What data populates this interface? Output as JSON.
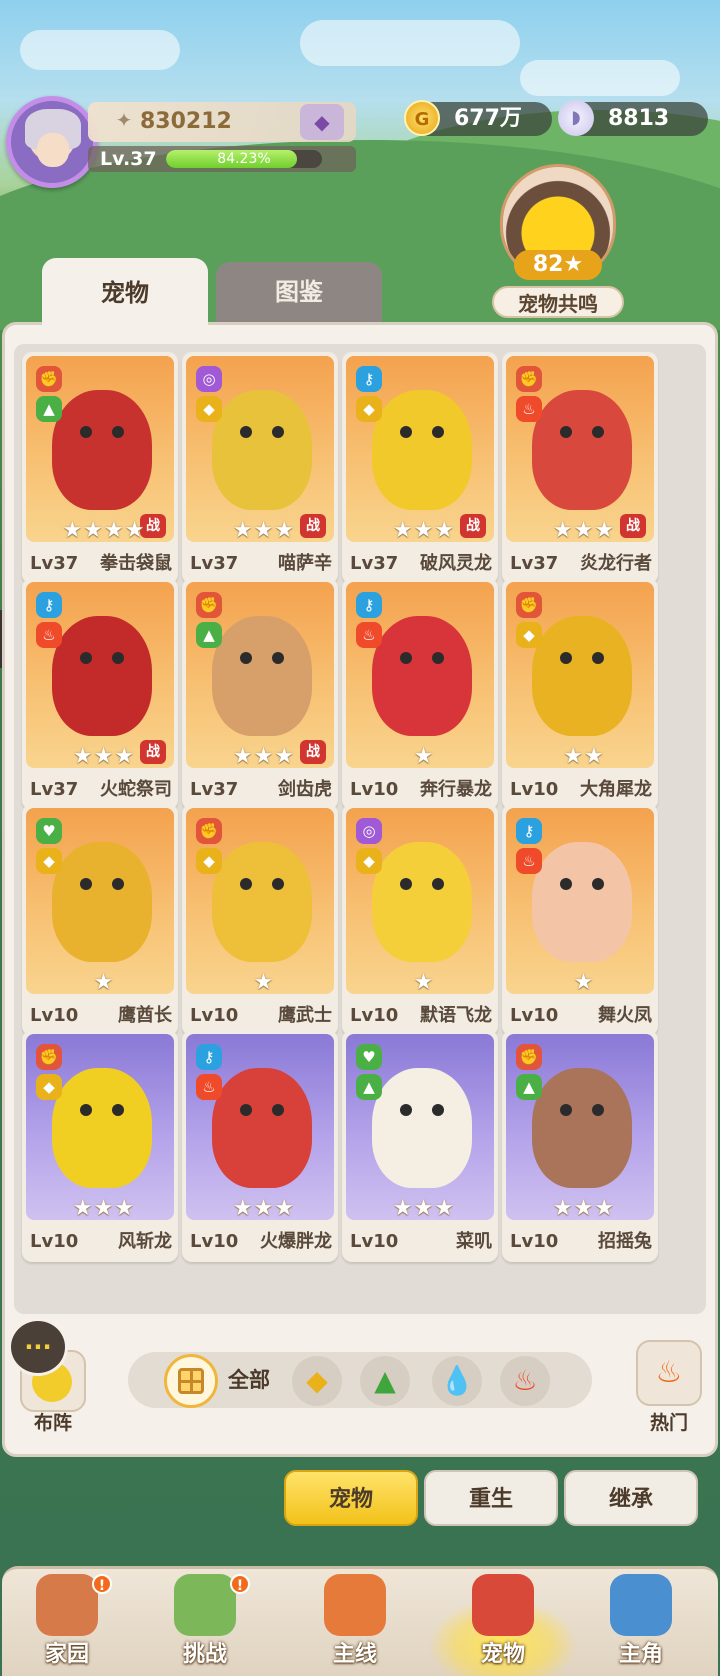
{
  "player": {
    "power": "830212",
    "level": "Lv.37",
    "exp_percent_text": "84.23%",
    "exp_fraction": 0.8423
  },
  "currency": {
    "gold": "677万",
    "shells": "8813"
  },
  "resonance": {
    "value": "82★",
    "label": "宠物共鸣"
  },
  "tabs": [
    {
      "label": "宠物",
      "active": true
    },
    {
      "label": "图鉴",
      "active": false
    }
  ],
  "pets": [
    {
      "level": "Lv37",
      "name": "拳击袋鼠",
      "stars": "★★★★",
      "war": "战",
      "frame": "orange",
      "badges": [
        "fist-icon",
        "leaf-icon"
      ],
      "badge_glyphs": [
        "✊",
        "▲"
      ],
      "badge_colors": [
        "#e2553a",
        "#4ab046"
      ],
      "body": "#c8322e"
    },
    {
      "level": "Lv37",
      "name": "喵萨辛",
      "stars": "★★★",
      "war": "战",
      "frame": "orange",
      "badges": [
        "magic-icon",
        "earth-icon"
      ],
      "badge_glyphs": [
        "◎",
        "◆"
      ],
      "badge_colors": [
        "#a05ad6",
        "#e9b21a"
      ],
      "body": "#e8c23a"
    },
    {
      "level": "Lv37",
      "name": "破风灵龙",
      "stars": "★★★",
      "war": "战",
      "frame": "orange",
      "badges": [
        "key-icon",
        "earth-icon"
      ],
      "badge_glyphs": [
        "⚷",
        "◆"
      ],
      "badge_colors": [
        "#2ba1e0",
        "#e9b21a"
      ],
      "body": "#f2c92a"
    },
    {
      "level": "Lv37",
      "name": "炎龙行者",
      "stars": "★★★",
      "war": "战",
      "frame": "orange",
      "badges": [
        "fist-icon",
        "fire-icon"
      ],
      "badge_glyphs": [
        "✊",
        "♨"
      ],
      "badge_colors": [
        "#e2553a",
        "#ef4a2a"
      ],
      "body": "#d9483c"
    },
    {
      "level": "Lv37",
      "name": "火蛇祭司",
      "stars": "★★★",
      "war": "战",
      "frame": "orange",
      "badges": [
        "key-icon",
        "fire-icon"
      ],
      "badge_glyphs": [
        "⚷",
        "♨"
      ],
      "badge_colors": [
        "#2ba1e0",
        "#ef4a2a"
      ],
      "body": "#c32a2a"
    },
    {
      "level": "Lv37",
      "name": "剑齿虎",
      "stars": "★★★",
      "war": "战",
      "frame": "orange",
      "badges": [
        "fist-icon",
        "leaf-icon"
      ],
      "badge_glyphs": [
        "✊",
        "▲"
      ],
      "badge_colors": [
        "#e2553a",
        "#4ab046"
      ],
      "body": "#d7a06a"
    },
    {
      "level": "Lv10",
      "name": "奔行暴龙",
      "stars": "★",
      "war": "",
      "frame": "orange",
      "badges": [
        "key-icon",
        "fire-icon"
      ],
      "badge_glyphs": [
        "⚷",
        "♨"
      ],
      "badge_colors": [
        "#2ba1e0",
        "#ef4a2a"
      ],
      "body": "#d8353a"
    },
    {
      "level": "Lv10",
      "name": "大角犀龙",
      "stars": "★★",
      "war": "",
      "frame": "orange",
      "badges": [
        "fist-icon",
        "earth-icon"
      ],
      "badge_glyphs": [
        "✊",
        "◆"
      ],
      "badge_colors": [
        "#e2553a",
        "#e9b21a"
      ],
      "body": "#e9b222"
    },
    {
      "level": "Lv10",
      "name": "鹰酋长",
      "stars": "★",
      "war": "",
      "frame": "orange",
      "badges": [
        "heart-icon",
        "earth-icon"
      ],
      "badge_glyphs": [
        "♥",
        "◆"
      ],
      "badge_colors": [
        "#4ab046",
        "#e9b21a"
      ],
      "body": "#e8b22e"
    },
    {
      "level": "Lv10",
      "name": "鹰武士",
      "stars": "★",
      "war": "",
      "frame": "orange",
      "badges": [
        "fist-icon",
        "earth-icon"
      ],
      "badge_glyphs": [
        "✊",
        "◆"
      ],
      "badge_colors": [
        "#e2553a",
        "#e9b21a"
      ],
      "body": "#eec03a"
    },
    {
      "level": "Lv10",
      "name": "默语飞龙",
      "stars": "★",
      "war": "",
      "frame": "orange",
      "badges": [
        "magic-icon",
        "earth-icon"
      ],
      "badge_glyphs": [
        "◎",
        "◆"
      ],
      "badge_colors": [
        "#a05ad6",
        "#e9b21a"
      ],
      "body": "#f4cf3a"
    },
    {
      "level": "Lv10",
      "name": "舞火凤",
      "stars": "★",
      "war": "",
      "frame": "orange",
      "badges": [
        "key-icon",
        "fire-icon"
      ],
      "badge_glyphs": [
        "⚷",
        "♨"
      ],
      "badge_colors": [
        "#2ba1e0",
        "#ef4a2a"
      ],
      "body": "#f4c4a6"
    },
    {
      "level": "Lv10",
      "name": "风斩龙",
      "stars": "★★★",
      "war": "",
      "frame": "purple",
      "badges": [
        "fist-icon",
        "earth-icon"
      ],
      "badge_glyphs": [
        "✊",
        "◆"
      ],
      "badge_colors": [
        "#e2553a",
        "#e9b21a"
      ],
      "body": "#f1cf22"
    },
    {
      "level": "Lv10",
      "name": "火爆胖龙",
      "stars": "★★★",
      "war": "",
      "frame": "purple",
      "badges": [
        "key-icon",
        "fire-icon"
      ],
      "badge_glyphs": [
        "⚷",
        "♨"
      ],
      "badge_colors": [
        "#2ba1e0",
        "#ef4a2a"
      ],
      "body": "#d8403a"
    },
    {
      "level": "Lv10",
      "name": "菜叽",
      "stars": "★★★",
      "war": "",
      "frame": "purple",
      "badges": [
        "heart-icon",
        "leaf-icon"
      ],
      "badge_glyphs": [
        "♥",
        "▲"
      ],
      "badge_colors": [
        "#4ab046",
        "#4ab046"
      ],
      "body": "#f4efe2"
    },
    {
      "level": "Lv10",
      "name": "招摇兔",
      "stars": "★★★",
      "war": "",
      "frame": "purple",
      "badges": [
        "fist-icon",
        "leaf-icon"
      ],
      "badge_glyphs": [
        "✊",
        "▲"
      ],
      "badge_colors": [
        "#e2553a",
        "#4ab046"
      ],
      "body": "#a9745a"
    }
  ],
  "filters": {
    "formation_label": "布阵",
    "all_label": "全部",
    "hot_label": "热门",
    "elements": [
      {
        "icon": "earth-icon",
        "glyph": "◆",
        "color": "#e9b21a"
      },
      {
        "icon": "leaf-icon",
        "glyph": "▲",
        "color": "#3fa63b"
      },
      {
        "icon": "water-icon",
        "glyph": "💧",
        "color": "#2ba1e0"
      },
      {
        "icon": "fire-icon",
        "glyph": "♨",
        "color": "#ef4a2a"
      }
    ]
  },
  "actions": {
    "pets": "宠物",
    "reborn": "重生",
    "inherit": "继承"
  },
  "nav": [
    {
      "label": "家园",
      "alert": "!",
      "color": "#d77a4a"
    },
    {
      "label": "挑战",
      "alert": "!",
      "color": "#7cb85a"
    },
    {
      "label": "主线",
      "alert": "",
      "color": "#e57a3a"
    },
    {
      "label": "宠物",
      "alert": "",
      "color": "#d9493a"
    },
    {
      "label": "主角",
      "alert": "",
      "color": "#4a8fd0"
    }
  ]
}
